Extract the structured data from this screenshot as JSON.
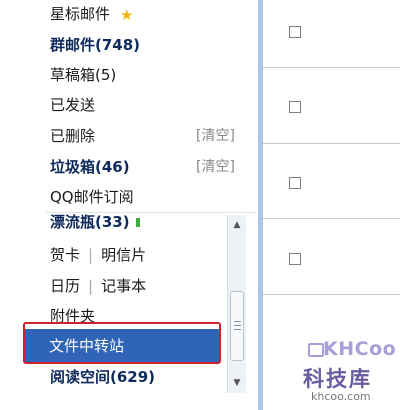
{
  "nav": {
    "starred": "星标邮件",
    "group_mail": "群邮件(748)",
    "drafts": "草稿箱(5)",
    "sent": "已发送",
    "deleted": "已删除",
    "spam": "垃圾箱(46)",
    "clear_label": "[清空]",
    "qq_subscribe": "QQ邮件订阅"
  },
  "lower": {
    "drift_bottle": "漂流瓶(33)",
    "greeting_card": "贺卡",
    "postcard": "明信片",
    "calendar": "日历",
    "notepad": "记事本",
    "attachments": "附件夹",
    "file_transfer": "文件中转站",
    "reading_space": "阅读空间(629)",
    "separator": "|"
  },
  "watermark": {
    "brand": "KHCoo",
    "name": "科技库",
    "url": "khcoo.com"
  },
  "colors": {
    "highlight": "#2f64b6",
    "red_box": "#c9232d",
    "star": "#f1b60f",
    "sidebar_edge": "#a9c7e9"
  }
}
